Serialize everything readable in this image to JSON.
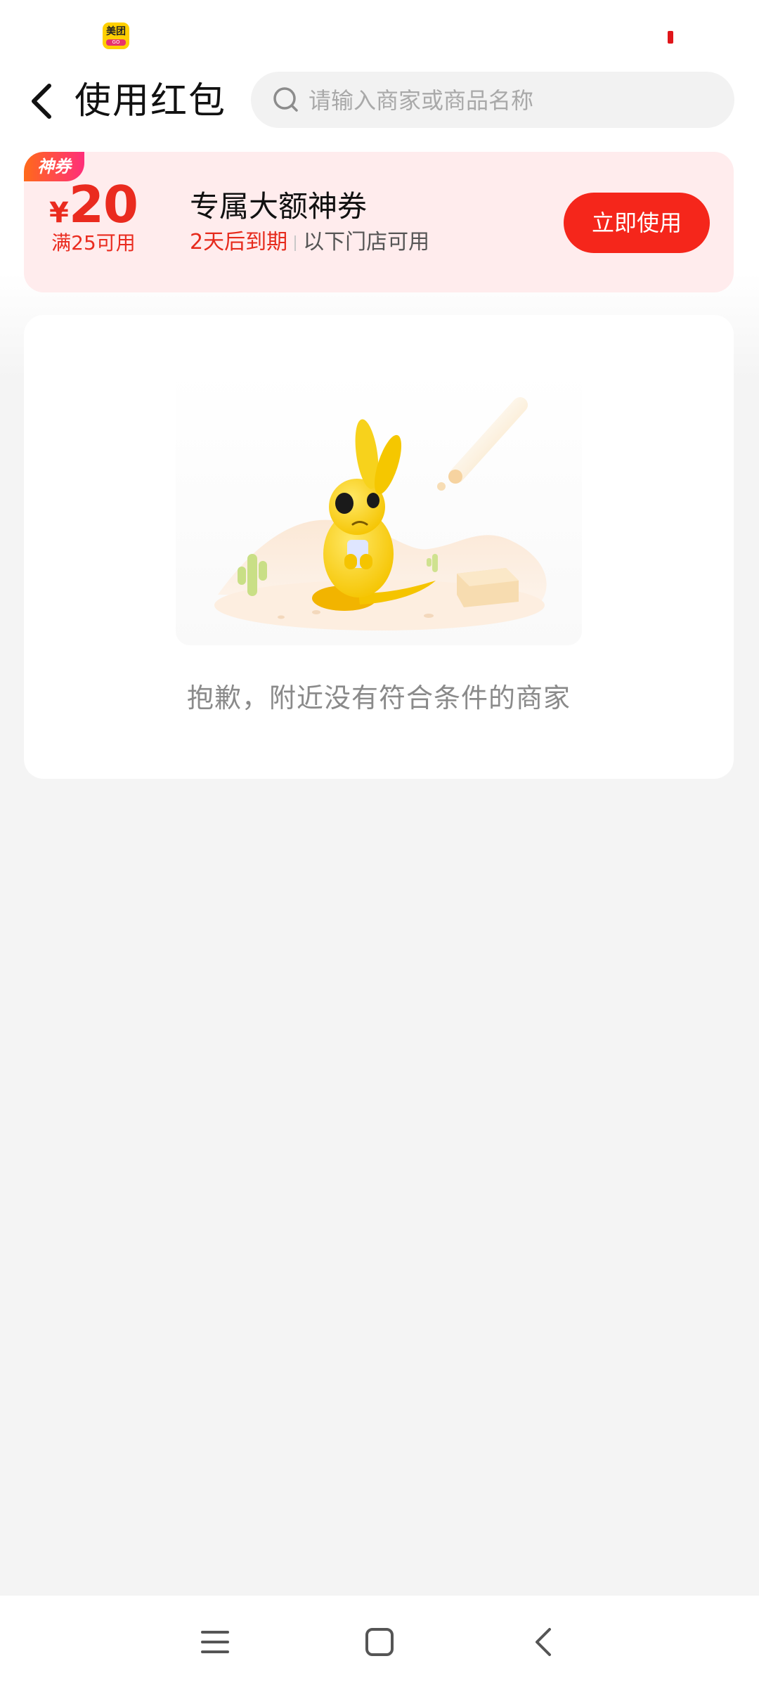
{
  "status_bar": {
    "app_icon": {
      "name": "meituan-app-icon",
      "label_top": "美团",
      "label_bottom": "GO",
      "color": "#ffd000"
    },
    "indicator_color": "#e0161a"
  },
  "header": {
    "back_icon": "chevron-left-icon",
    "title": "使用红包",
    "search": {
      "icon": "search-icon",
      "placeholder": "请输入商家或商品名称",
      "value": ""
    }
  },
  "coupon": {
    "tag": "神券",
    "currency": "¥",
    "amount": "20",
    "threshold": "满25可用",
    "title": "专属大额神券",
    "expiry": "2天后到期",
    "scope": "以下门店可用",
    "action_label": "立即使用",
    "colors": {
      "accent": "#f5261b",
      "background": "#ffeced"
    }
  },
  "empty_state": {
    "illustration": "kangaroo-desert-empty-illustration",
    "message": "抱歉，附近没有符合条件的商家"
  },
  "nav_bar": {
    "items": [
      {
        "name": "menu-icon"
      },
      {
        "name": "home-icon"
      },
      {
        "name": "back-icon"
      }
    ]
  }
}
